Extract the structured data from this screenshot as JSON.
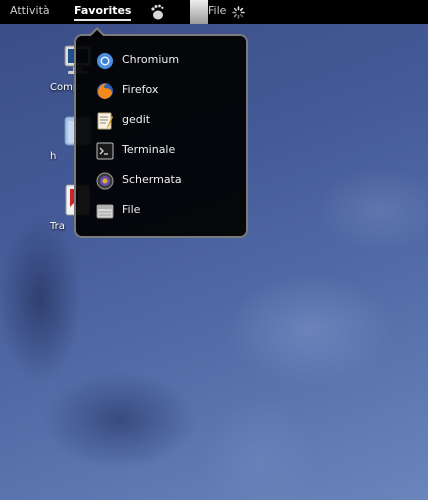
{
  "panel": {
    "activities": "Attività",
    "favorites": "Favorites",
    "app_menu_label": "File"
  },
  "desktop": {
    "icons": [
      {
        "label": "Comp",
        "icon": "computer-icon"
      },
      {
        "label": "h",
        "icon": "home-folder-icon"
      },
      {
        "label": "Tra",
        "icon": "trash-icon"
      }
    ]
  },
  "favorites_menu": {
    "items": [
      {
        "label": "Chromium",
        "icon": "chromium-icon"
      },
      {
        "label": "Firefox",
        "icon": "firefox-icon"
      },
      {
        "label": "gedit",
        "icon": "gedit-icon"
      },
      {
        "label": "Terminale",
        "icon": "terminal-icon"
      },
      {
        "label": "Schermata",
        "icon": "screenshot-icon"
      },
      {
        "label": "File",
        "icon": "files-icon"
      }
    ]
  },
  "colors": {
    "panel_bg": "#000000",
    "menu_bg": "#000000",
    "menu_border": "#7b7b7b",
    "desktop_bg": "#445a98"
  }
}
